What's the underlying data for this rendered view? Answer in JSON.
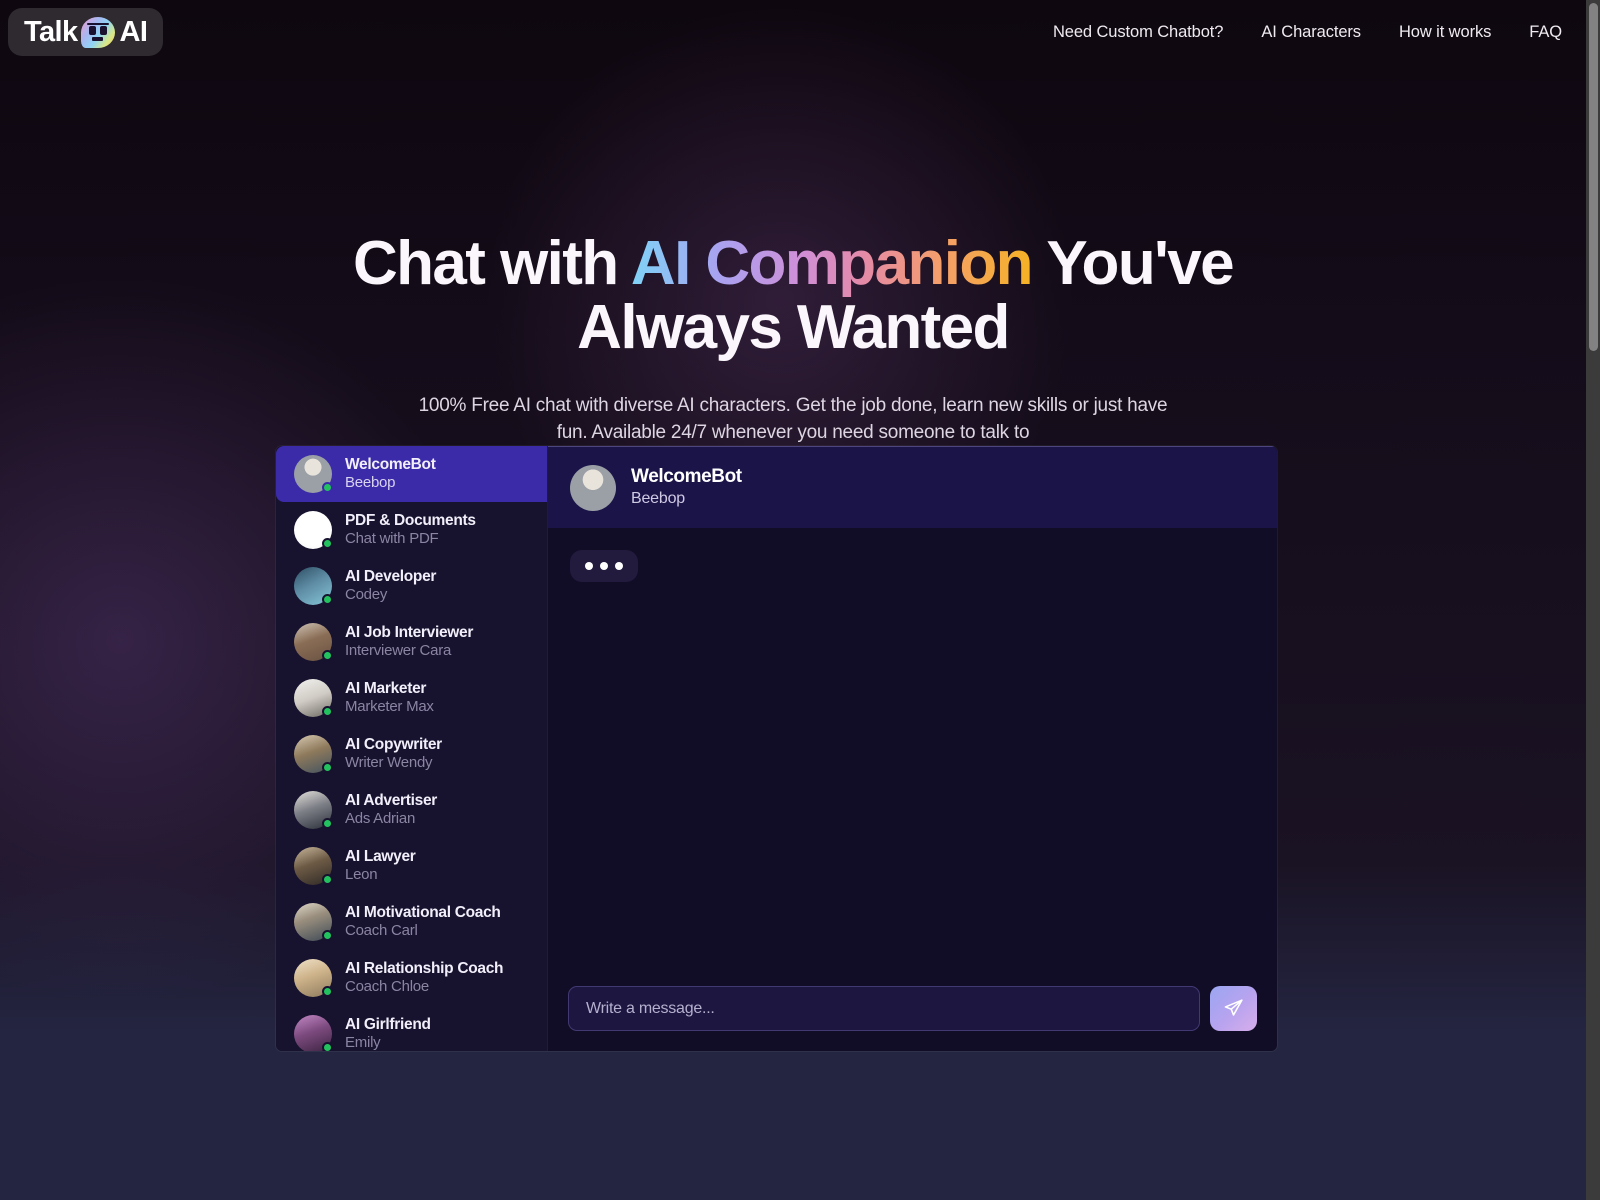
{
  "header": {
    "logo": {
      "text_left": "Talk",
      "text_right": "AI",
      "icon": "speech-bubble-face-icon"
    },
    "nav": [
      {
        "label": "Need Custom Chatbot?"
      },
      {
        "label": "AI Characters"
      },
      {
        "label": "How it works"
      },
      {
        "label": "FAQ"
      }
    ]
  },
  "hero": {
    "title_part1": "Chat with ",
    "title_gradient": "AI Companion",
    "title_part2": " You've Always Wanted",
    "subtitle": "100% Free AI chat with diverse AI characters. Get the job done, learn new skills or just have fun. Available 24/7 whenever you need someone to talk to",
    "gradient_colors": [
      "#7fd3f7",
      "#a9a2f0",
      "#cf8fd8",
      "#e48aa8",
      "#f59f68",
      "#f5b324"
    ]
  },
  "widget": {
    "characters": [
      {
        "name": "WelcomeBot",
        "persona": "Beebop",
        "status": "online",
        "selected": true,
        "avatar": "robot"
      },
      {
        "name": "PDF & Documents",
        "persona": "Chat with PDF",
        "status": "online",
        "selected": false,
        "avatar": "document-mascot"
      },
      {
        "name": "AI Developer",
        "persona": "Codey",
        "status": "online",
        "selected": false,
        "avatar": "cyber-face"
      },
      {
        "name": "AI Job Interviewer",
        "persona": "Interviewer Cara",
        "status": "online",
        "selected": false,
        "avatar": "woman-suit"
      },
      {
        "name": "AI Marketer",
        "persona": "Marketer Max",
        "status": "online",
        "selected": false,
        "avatar": "man-white-shirt"
      },
      {
        "name": "AI Copywriter",
        "persona": "Writer Wendy",
        "status": "online",
        "selected": false,
        "avatar": "woman-glasses"
      },
      {
        "name": "AI Advertiser",
        "persona": "Ads Adrian",
        "status": "online",
        "selected": false,
        "avatar": "man-suit-glasses"
      },
      {
        "name": "AI Lawyer",
        "persona": "Leon",
        "status": "online",
        "selected": false,
        "avatar": "man-desk"
      },
      {
        "name": "AI Motivational Coach",
        "persona": "Coach Carl",
        "status": "online",
        "selected": false,
        "avatar": "man-beard"
      },
      {
        "name": "AI Relationship Coach",
        "persona": "Coach Chloe",
        "status": "online",
        "selected": false,
        "avatar": "blonde-woman"
      },
      {
        "name": "AI Girlfriend",
        "persona": "Emily",
        "status": "online",
        "selected": false,
        "avatar": "woman-pink"
      }
    ],
    "chat_header": {
      "name": "WelcomeBot",
      "persona": "Beebop",
      "avatar": "robot"
    },
    "typing_indicator": {
      "visible": true,
      "dots": 3
    },
    "composer": {
      "placeholder": "Write a message...",
      "value": "",
      "send_icon": "paper-plane-icon"
    }
  },
  "colors": {
    "selected_item": "#3b2ba8",
    "list_bg": "#17122e",
    "chat_header_bg": "#1b1449",
    "online_dot": "#22c35e",
    "page_bottom": "#242541"
  }
}
